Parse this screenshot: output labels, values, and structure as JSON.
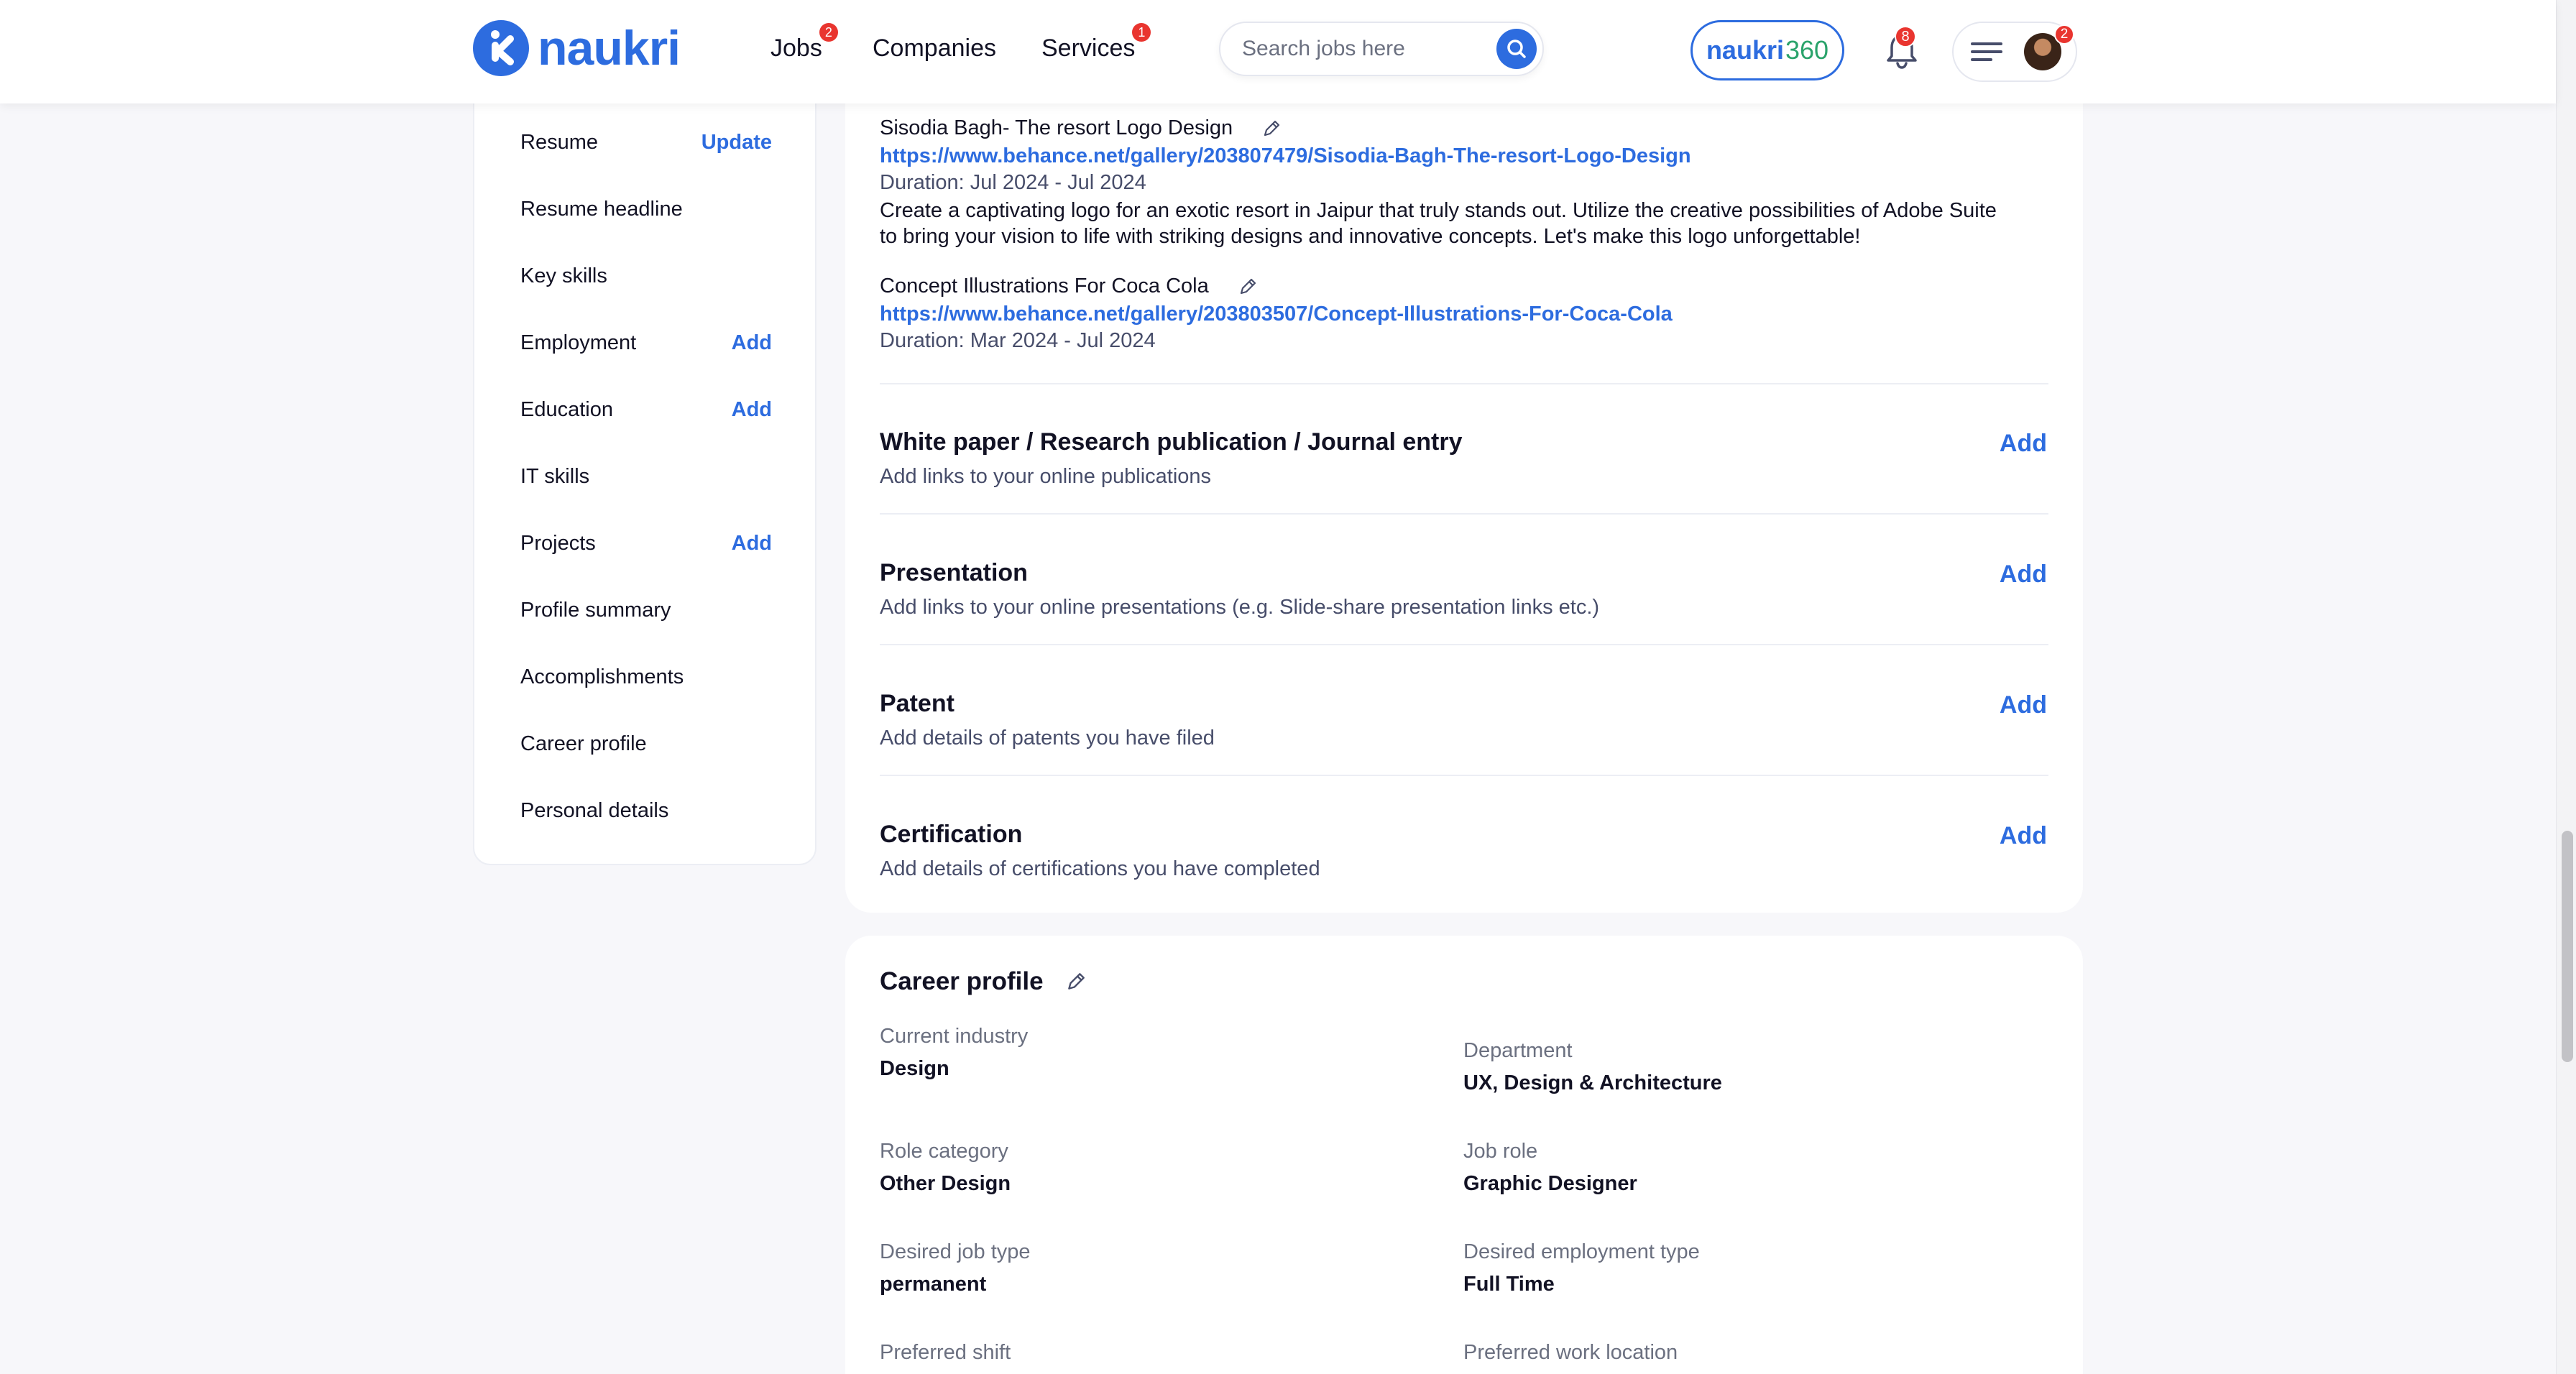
{
  "header": {
    "logo_text": "naukri",
    "nav": [
      {
        "label": "Jobs",
        "badge": "2"
      },
      {
        "label": "Companies",
        "badge": ""
      },
      {
        "label": "Services",
        "badge": "1"
      }
    ],
    "search_placeholder": "Search jobs here",
    "naukri360_brand": "naukri",
    "naukri360_num": "360",
    "bell_badge": "8",
    "avatar_badge": "2"
  },
  "sidebar": {
    "items": [
      {
        "label": "Resume",
        "action": "Update"
      },
      {
        "label": "Resume headline",
        "action": ""
      },
      {
        "label": "Key skills",
        "action": ""
      },
      {
        "label": "Employment",
        "action": "Add"
      },
      {
        "label": "Education",
        "action": "Add"
      },
      {
        "label": "IT skills",
        "action": ""
      },
      {
        "label": "Projects",
        "action": "Add"
      },
      {
        "label": "Profile summary",
        "action": ""
      },
      {
        "label": "Accomplishments",
        "action": ""
      },
      {
        "label": "Career profile",
        "action": ""
      },
      {
        "label": "Personal details",
        "action": ""
      }
    ]
  },
  "projects": [
    {
      "title": "Sisodia Bagh- The resort Logo Design",
      "link": "https://www.behance.net/gallery/203807479/Sisodia-Bagh-The-resort-Logo-Design",
      "duration": "Duration: Jul 2024 - Jul 2024",
      "description": "Create a captivating logo for an exotic resort in Jaipur that truly stands out. Utilize the creative possibilities of Adobe Suite to bring your vision to life with striking designs and innovative concepts. Let's make this logo unforgettable!"
    },
    {
      "title": "Concept Illustrations For Coca Cola",
      "link": "https://www.behance.net/gallery/203803507/Concept-Illustrations-For-Coca-Cola",
      "duration": "Duration: Mar 2024 - Jul 2024",
      "description": ""
    }
  ],
  "accomplishments": [
    {
      "title": "White paper / Research publication / Journal entry",
      "subtitle": "Add links to your online publications",
      "action": "Add"
    },
    {
      "title": "Presentation",
      "subtitle": "Add links to your online presentations (e.g. Slide-share presentation links etc.)",
      "action": "Add"
    },
    {
      "title": "Patent",
      "subtitle": "Add details of patents you have filed",
      "action": "Add"
    },
    {
      "title": "Certification",
      "subtitle": "Add details of certifications you have completed",
      "action": "Add"
    }
  ],
  "career_profile": {
    "title": "Career profile",
    "fields": [
      {
        "label": "Current industry",
        "value": "Design"
      },
      {
        "label": "Department",
        "value": "UX, Design & Architecture"
      },
      {
        "label": "Role category",
        "value": "Other Design"
      },
      {
        "label": "Job role",
        "value": "Graphic Designer"
      },
      {
        "label": "Desired job type",
        "value": "permanent"
      },
      {
        "label": "Desired employment type",
        "value": "Full Time"
      },
      {
        "label": "Preferred shift",
        "value": ""
      },
      {
        "label": "Preferred work location",
        "value": ""
      }
    ]
  },
  "icons": {
    "logo": "naukri-logo-icon",
    "search": "search-icon",
    "bell": "bell-icon",
    "menu": "hamburger-menu-icon",
    "edit": "pencil-edit-icon"
  },
  "colors": {
    "brand_blue": "#2d6cdf",
    "badge_red": "#e9352f",
    "page_bg": "#f7f7fa",
    "green_360": "#2aa36b"
  }
}
